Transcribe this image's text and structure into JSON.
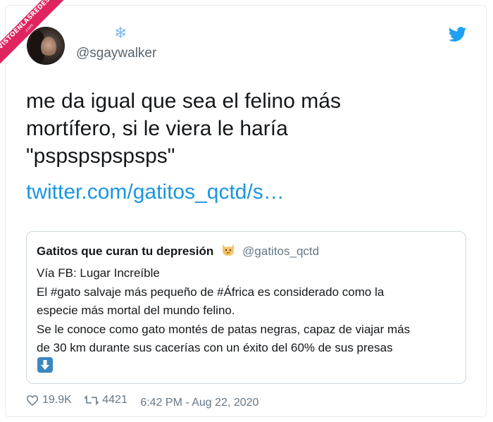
{
  "watermark": {
    "line1": "VISTOENLASREDES",
    "line2": ".com"
  },
  "author": {
    "avatar_icon": "avatar",
    "decoration": "❄",
    "handle": "@sgaywalker"
  },
  "tweet": {
    "text_lines": [
      "me da igual que sea el felino más",
      "mortífero, si le viera le haría",
      "\"pspspspspsps\""
    ],
    "link": "twitter.com/gatitos_qctd/s…"
  },
  "quoted_tweet": {
    "name": "Gatitos que curan tu depresión",
    "emoji_icon": "cat-face-icon",
    "handle": "@gatitos_qctd",
    "lines": [
      "Vía FB: Lugar Increíble",
      "El #gato salvaje más pequeño de #África es considerado como la",
      "especie más mortal del mundo felino.",
      "Se le conoce como gato montés de patas negras, capaz de viajar más",
      "de 30 km durante sus cacerías con un éxito del 60% de sus presas"
    ],
    "trailing_emoji": "down-arrow-icon"
  },
  "footer": {
    "likes": "19.9K",
    "retweets": "4421",
    "timestamp": "6:42 PM - Aug 22, 2020"
  },
  "colors": {
    "link": "#1b95e0",
    "twitter_blue": "#1da1f2",
    "text": "#14171a",
    "muted": "#657786"
  }
}
